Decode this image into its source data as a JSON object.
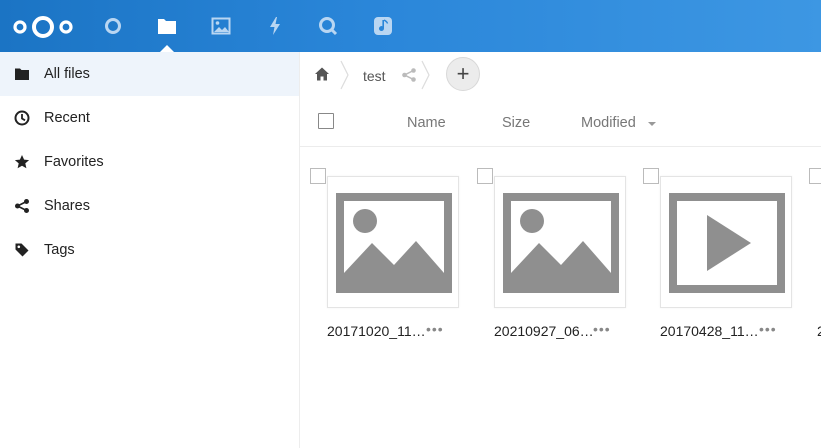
{
  "header": {
    "apps": [
      {
        "name": "dashboard",
        "icon": "circle-icon"
      },
      {
        "name": "files",
        "icon": "folder-icon",
        "active": true
      },
      {
        "name": "photos",
        "icon": "image-icon"
      },
      {
        "name": "activity",
        "icon": "lightning-icon"
      },
      {
        "name": "search",
        "icon": "search-icon"
      },
      {
        "name": "music",
        "icon": "music-note-icon"
      }
    ]
  },
  "sidebar": {
    "items": [
      {
        "label": "All files",
        "icon": "folder-icon",
        "active": true
      },
      {
        "label": "Recent",
        "icon": "clock-icon"
      },
      {
        "label": "Favorites",
        "icon": "star-icon"
      },
      {
        "label": "Shares",
        "icon": "share-icon"
      },
      {
        "label": "Tags",
        "icon": "tag-icon"
      }
    ]
  },
  "breadcrumb": {
    "current": "test",
    "add_label": "+"
  },
  "file_list": {
    "columns": {
      "name": "Name",
      "size": "Size",
      "modified": "Modified"
    },
    "files": [
      {
        "name": "20171020_11…",
        "type": "image",
        "menu": "•••"
      },
      {
        "name": "20210927_06…",
        "type": "image",
        "menu": "•••"
      },
      {
        "name": "20170428_11…",
        "type": "video",
        "menu": "•••"
      },
      {
        "name": "2",
        "type": "partial"
      }
    ]
  },
  "colors": {
    "header_gradient_start": "#1b74c4",
    "header_gradient_end": "#3d97e3",
    "active_nav_bg": "#eef4fb",
    "thumb_grey": "#8f8f8f"
  }
}
